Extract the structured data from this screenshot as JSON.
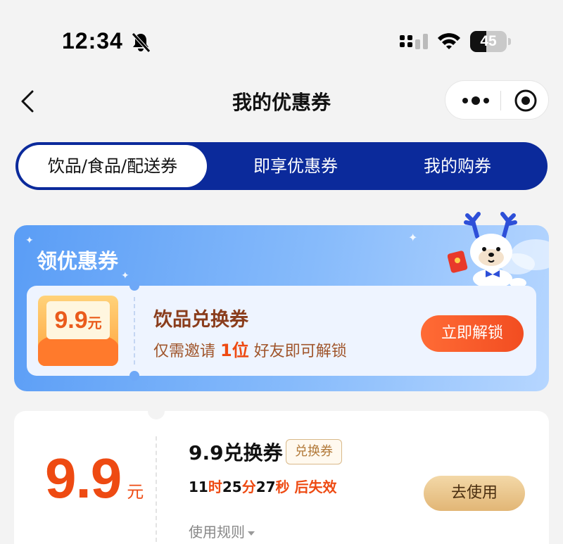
{
  "status_bar": {
    "time": "12:34",
    "battery_percent": "45",
    "battery_level": 0.45,
    "icons": [
      "bell-slash-icon",
      "cellular-signal-icon",
      "wifi-icon",
      "battery-icon"
    ]
  },
  "nav": {
    "title": "我的优惠券",
    "icons": [
      "back-chevron-icon",
      "more-dots-icon",
      "close-target-icon"
    ]
  },
  "tabs": [
    {
      "label": "饮品/食品/配送券",
      "active": true
    },
    {
      "label": "即享优惠券",
      "active": false
    },
    {
      "label": "我的购券",
      "active": false
    }
  ],
  "promo": {
    "heading": "领优惠券",
    "voucher": {
      "amount": "9.9",
      "unit": "元"
    },
    "coupon_name": "饮品兑换券",
    "desc_prefix": "仅需邀请 ",
    "desc_highlight": "1位",
    "desc_suffix": " 好友即可解锁",
    "button": "立即解锁",
    "colors": {
      "accent": "#f24d21",
      "bg": "#5a9df6"
    }
  },
  "my_coupon": {
    "amount": "9.9",
    "unit": "元",
    "title": "9.9兑换券",
    "badge": "兑换券",
    "countdown": {
      "h": "11",
      "h_unit": "时",
      "m": "25",
      "m_unit": "分",
      "s": "27",
      "s_unit": "秒",
      "suffix": " 后失效"
    },
    "use_button": "去使用",
    "rules_link": "使用规则"
  },
  "colors": {
    "tab_bg": "#0b2a9b",
    "highlight": "#ee4a12"
  }
}
